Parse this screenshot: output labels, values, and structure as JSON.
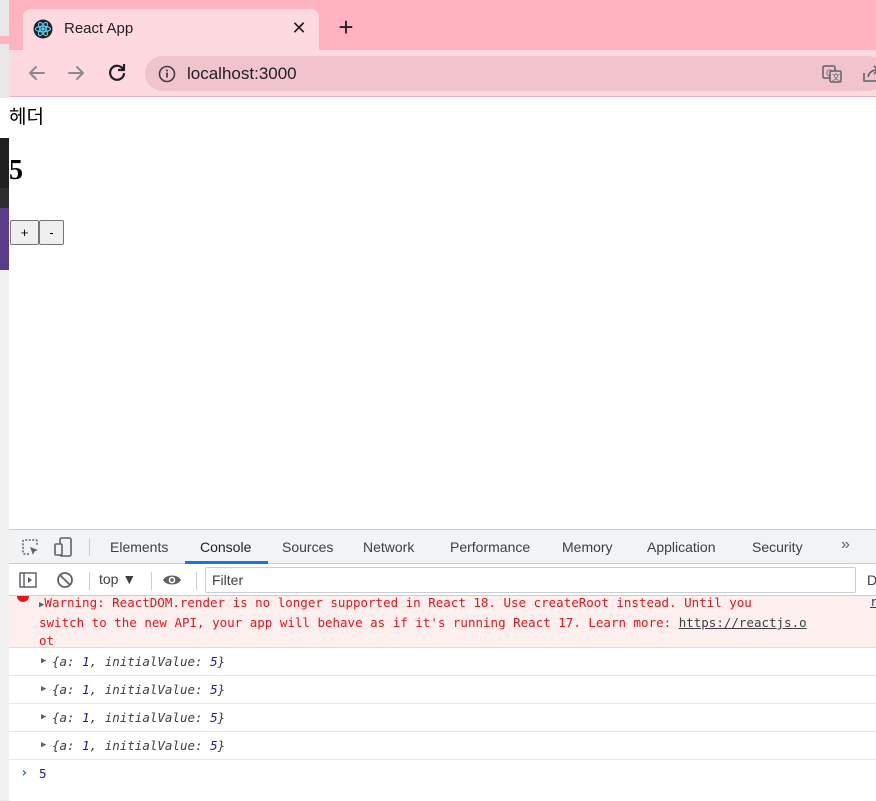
{
  "browser": {
    "tab_title": "React App",
    "tab_close": "✕",
    "new_tab": "+",
    "url": "localhost:3000"
  },
  "page": {
    "header": "헤더",
    "count": "5",
    "plus_label": "+",
    "minus_label": "-"
  },
  "devtools": {
    "tabs": [
      "Elements",
      "Console",
      "Sources",
      "Network",
      "Performance",
      "Memory",
      "Application",
      "Security"
    ],
    "more_tabs": "»",
    "active_tab": "Console",
    "context": "top ▼",
    "filter_placeholder": "Filter",
    "levels_truncated": "D",
    "warning": {
      "line1": "Warning: ReactDOM.render is no longer supported in React 18. Use createRoot instead. Until you",
      "line2_prefix": "switch to the new API, your app will behave as if it's running React 17. Learn more: ",
      "link": "https://reactjs.o",
      "line3": "ot",
      "source": "r"
    },
    "logs": [
      {
        "prefix": "{a: ",
        "a": "1",
        "mid": ", initialValue: ",
        "value": "5",
        "suffix": "}"
      },
      {
        "prefix": "{a: ",
        "a": "1",
        "mid": ", initialValue: ",
        "value": "5",
        "suffix": "}"
      },
      {
        "prefix": "{a: ",
        "a": "1",
        "mid": ", initialValue: ",
        "value": "5",
        "suffix": "}"
      },
      {
        "prefix": "{a: ",
        "a": "1",
        "mid": ", initialValue: ",
        "value": "5",
        "suffix": "}"
      }
    ],
    "result": "5"
  },
  "colors": {
    "tabstrip": "#ffb3c1",
    "toolbar": "#ffd9e0",
    "accent": "#1a73e8",
    "error": "#e8141d"
  }
}
